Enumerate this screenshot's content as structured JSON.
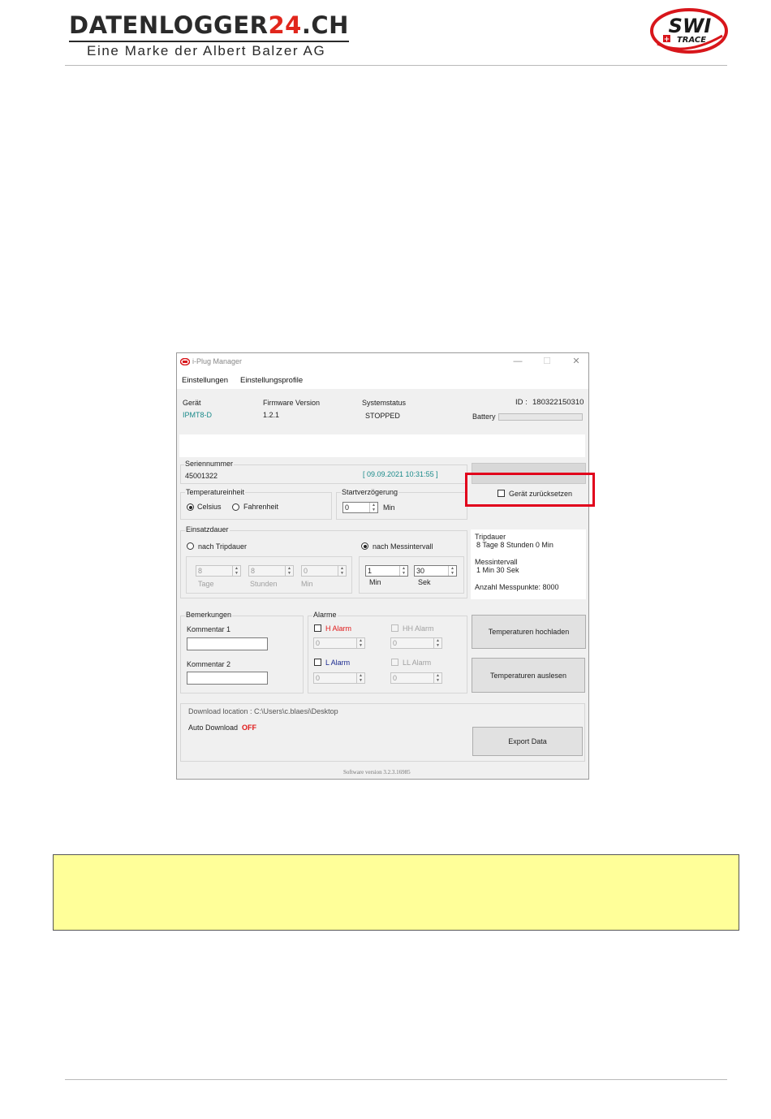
{
  "header": {
    "brand_main": "DATENLOGGER",
    "brand_accent": "24",
    "brand_suffix": ".CH",
    "brand_subtitle": "Eine Marke der Albert Balzer AG",
    "partner_logo_text": "SWI TRACE",
    "partner_logo_icon": "swi-trace-logo"
  },
  "window": {
    "title": "i-Plug Manager",
    "controls": {
      "minimize": "—",
      "maximize": "☐",
      "close": "✕"
    }
  },
  "menu": {
    "items": [
      "Einstellungen",
      "Einstellungsprofile"
    ]
  },
  "device_info": {
    "device_label": "Gerät",
    "device_value": "IPMT8-D",
    "firmware_label": "Firmware Version",
    "firmware_value": "1.2.1",
    "status_label": "Systemstatus",
    "status_value": "STOPPED",
    "id_label": "ID :",
    "id_value": "180322150310",
    "battery_label": "Battery",
    "battery_level": 0
  },
  "serial": {
    "title": "Seriennummer",
    "value": "45001322",
    "timestamp": "[ 09.09.2021 10:31:55 ]"
  },
  "reset": {
    "label": "Gerät zurücksetzen",
    "checked": false
  },
  "temp_unit": {
    "title": "Temperatureinheit",
    "options": [
      "Celsius",
      "Fahrenheit"
    ],
    "selected": "Celsius"
  },
  "start_delay": {
    "title": "Startverzögerung",
    "value": "0",
    "unit": "Min"
  },
  "duration": {
    "title": "Einsatzdauer",
    "option_trip": "nach Tripdauer",
    "option_interval": "nach Messintervall",
    "selected": "nach Messintervall",
    "trip_days": "8",
    "trip_hours": "8",
    "trip_minutes": "0",
    "label_days": "Tage",
    "label_hours": "Stunden",
    "label_minutes": "Min",
    "interval_minutes": "1",
    "interval_seconds": "30",
    "label_interval_min": "Min",
    "label_interval_sec": "Sek"
  },
  "summary": {
    "trip_title": "Tripdauer",
    "trip_value": "8 Tage 8 Stunden 0 Min",
    "interval_title": "Messintervall",
    "interval_value": "1 Min 30 Sek",
    "points_label": "Anzahl Messpunkte: 8000"
  },
  "remarks": {
    "title": "Bemerkungen",
    "comment1_label": "Kommentar 1",
    "comment1_value": "",
    "comment2_label": "Kommentar 2",
    "comment2_value": ""
  },
  "alarms": {
    "title": "Alarme",
    "h_label": "H Alarm",
    "h_value": "0",
    "hh_label": "HH Alarm",
    "hh_value": "0",
    "l_label": "L Alarm",
    "l_value": "0",
    "ll_label": "LL Alarm",
    "ll_value": "0"
  },
  "buttons": {
    "upload_temps": "Temperaturen hochladen",
    "read_temps": "Temperaturen auslesen",
    "export": "Export Data"
  },
  "download": {
    "location": "Download location : C:\\Users\\c.blaesi\\Desktop",
    "auto_label": "Auto Download",
    "auto_value": "OFF"
  },
  "footer": {
    "version": "Software version 3.2.3.16985"
  },
  "colors": {
    "brand_red": "#e1261c",
    "highlight_red": "#e1001b",
    "teal_value": "#1a8a8a",
    "note_yellow": "#ffff99",
    "status_off": "#e01818"
  }
}
